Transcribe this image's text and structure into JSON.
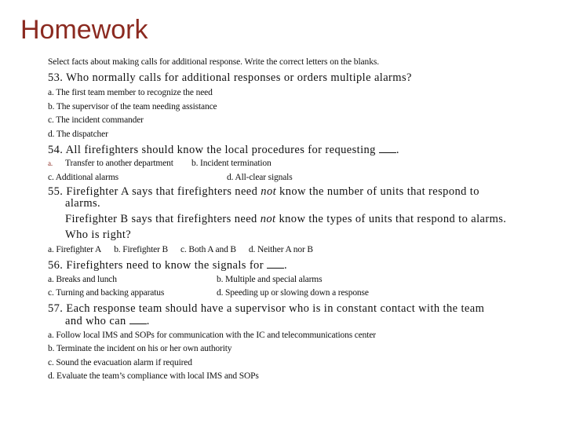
{
  "slide": {
    "title": "Homework",
    "instructions": "Select facts about making calls for additional response. Write the correct letters on the blanks.",
    "questions": [
      {
        "number": "53.",
        "text": "Who normally calls for additional responses or orders multiple alarms?",
        "options": [
          "a. The first team member to recognize the need",
          "b. The supervisor of the team needing assistance",
          "c. The incident commander",
          "d. The dispatcher"
        ]
      },
      {
        "number": "54.",
        "text": "All firefighters should know the local procedures for requesting",
        "blank_suffix": ".",
        "options": [
          {
            "marker": "a.",
            "text": "Transfer to another department"
          },
          "b. Incident termination",
          "c. Additional alarms",
          "d. All-clear signals"
        ]
      },
      {
        "number": "55.",
        "line1_pre": "Firefighter A says that firefighters need ",
        "line1_em": "not",
        "line1_post": " know the number of units that respond to",
        "line1_cont": "alarms.",
        "line2_pre": "Firefighter B says that firefighters need ",
        "line2_em": "not",
        "line2_post": " know the types of units that respond to alarms.",
        "line3": "Who is right?",
        "options": [
          "a. Firefighter A",
          "b. Firefighter B",
          "c. Both A and B",
          "d. Neither A nor B"
        ]
      },
      {
        "number": "56.",
        "text": "Firefighters need to know the signals for",
        "blank_suffix": ".",
        "options": [
          "a. Breaks and lunch",
          "b. Multiple and special alarms",
          "c. Turning and backing apparatus",
          "d. Speeding up or slowing down a response"
        ]
      },
      {
        "number": "57.",
        "text": "Each response team should have a supervisor who is in constant contact with the team",
        "text_cont": "and who can",
        "blank_suffix": ".",
        "options": [
          "a. Follow local IMS and SOPs for communication with the IC and telecommunications center",
          "b. Terminate the incident on his or her own authority",
          "c. Sound the evacuation alarm if required",
          "d. Evaluate the team’s compliance with local IMS and SOPs"
        ]
      }
    ],
    "colors": {
      "title": "#8B2A20",
      "text": "#111111",
      "background": "#ffffff"
    }
  }
}
